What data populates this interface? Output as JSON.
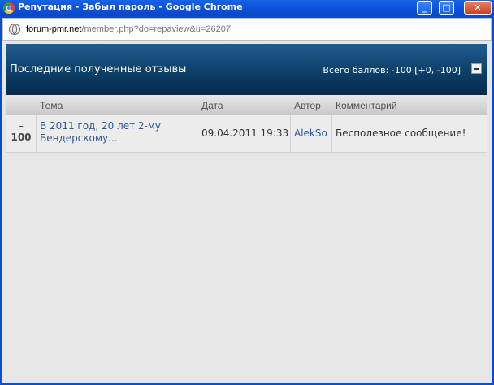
{
  "window": {
    "title": "Репутация - Забыл пароль - Google Chrome",
    "controls": {
      "minimize": "_",
      "maximize": "□",
      "close": "✕"
    }
  },
  "address": {
    "domain": "forum-pmr.net",
    "path": "/member.php?do=repaview&u=26207"
  },
  "panel": {
    "title": "Последние полученные отзывы",
    "total": "Всего баллов: -100 [+0, -100]"
  },
  "table": {
    "headers": {
      "topic": "Тема",
      "date": "Дата",
      "author": "Автор",
      "comment": "Комментарий"
    },
    "rows": [
      {
        "sign": "–",
        "score": "100",
        "topic": "В 2011 год, 20 лет 2-му Бендерскому...",
        "date": "09.04.2011 19:33",
        "author": "AlekSo",
        "comment": "Бесполезное сообщение!"
      }
    ]
  },
  "colors": {
    "header_top": "#1f5d8f",
    "header_bottom": "#062a4b",
    "link": "#2b5a9a",
    "content_bg": "#e6e6e6"
  }
}
